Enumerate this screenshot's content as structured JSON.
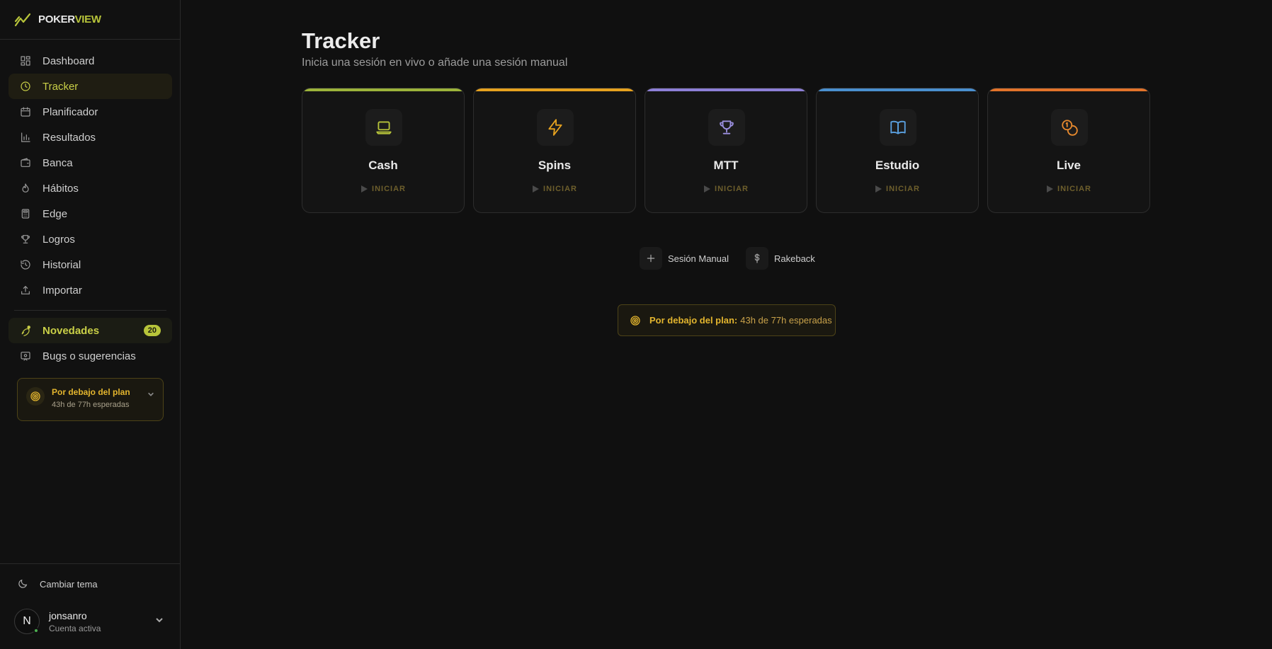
{
  "brand": {
    "name_part1": "POKER",
    "name_part2": "VIEW",
    "accent": "#b7c43a"
  },
  "sidebar": {
    "items": [
      {
        "label": "Dashboard",
        "icon": "dashboard-icon"
      },
      {
        "label": "Tracker",
        "icon": "clock-icon",
        "active": true
      },
      {
        "label": "Planificador",
        "icon": "calendar-icon"
      },
      {
        "label": "Resultados",
        "icon": "bar-chart-icon"
      },
      {
        "label": "Banca",
        "icon": "wallet-icon"
      },
      {
        "label": "Hábitos",
        "icon": "flame-icon"
      },
      {
        "label": "Edge",
        "icon": "calculator-icon"
      },
      {
        "label": "Logros",
        "icon": "trophy-icon"
      },
      {
        "label": "Historial",
        "icon": "history-icon"
      },
      {
        "label": "Importar",
        "icon": "upload-icon"
      }
    ],
    "novedades": {
      "label": "Novedades",
      "count": "20",
      "icon": "rocket-icon"
    },
    "bugs": {
      "label": "Bugs o sugerencias",
      "icon": "feedback-icon"
    },
    "plan": {
      "title": "Por debajo del plan",
      "detail": "43h de 77h esperadas"
    },
    "theme_toggle": "Cambiar tema",
    "user": {
      "initial": "N",
      "name": "jonsanro",
      "status": "Cuenta activa"
    }
  },
  "main": {
    "title": "Tracker",
    "subtitle": "Inicia una sesión en vivo o añade una sesión manual",
    "cards": [
      {
        "label": "Cash",
        "action": "INICIAR",
        "color": "#9cb33a",
        "icon": "laptop-icon"
      },
      {
        "label": "Spins",
        "action": "INICIAR",
        "color": "#e6a21f",
        "icon": "lightning-icon"
      },
      {
        "label": "MTT",
        "action": "INICIAR",
        "color": "#8d7fd6",
        "icon": "trophy-icon"
      },
      {
        "label": "Estudio",
        "action": "INICIAR",
        "color": "#4a8fcf",
        "icon": "book-icon"
      },
      {
        "label": "Live",
        "action": "INICIAR",
        "color": "#e2732a",
        "icon": "coins-icon"
      }
    ],
    "actions": [
      {
        "label": "Sesión Manual",
        "icon": "plus-icon"
      },
      {
        "label": "Rakeback",
        "icon": "dollar-icon"
      }
    ],
    "banner": {
      "title": "Por debajo del plan:",
      "detail": "43h de 77h esperadas"
    }
  }
}
